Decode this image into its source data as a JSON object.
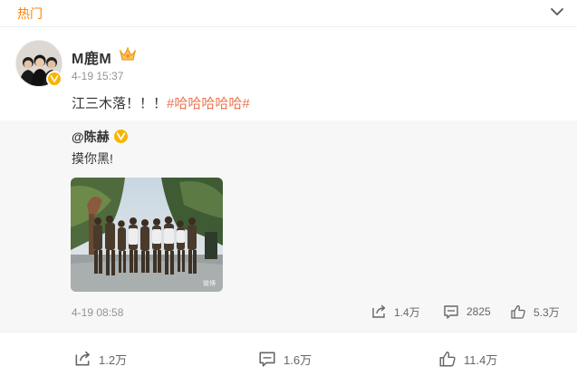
{
  "section": {
    "label": "热门"
  },
  "post": {
    "username": "M鹿M",
    "time": "4-19 15:37",
    "text": "江三木落！！！",
    "hashtag": "#哈哈哈哈哈#"
  },
  "repost": {
    "author": "@陈赫",
    "text": "摸你黑!",
    "image_watermark": "微博",
    "time": "4-19 08:58",
    "shares": "1.4万",
    "comments": "2825",
    "likes": "5.3万"
  },
  "footer": {
    "shares": "1.2万",
    "comments": "1.6万",
    "likes": "11.4万"
  },
  "icons": {
    "collapse": "chevron-down-icon",
    "crown": "vip-crown-icon",
    "verified": "verified-badge-icon",
    "share": "share-icon",
    "comment": "comment-icon",
    "like": "thumbs-up-icon"
  },
  "colors": {
    "accent": "#ff8200",
    "hashtag": "#eb7350",
    "verified": "#f7b500",
    "muted": "#939393",
    "repost_bg": "#f7f7f7"
  }
}
